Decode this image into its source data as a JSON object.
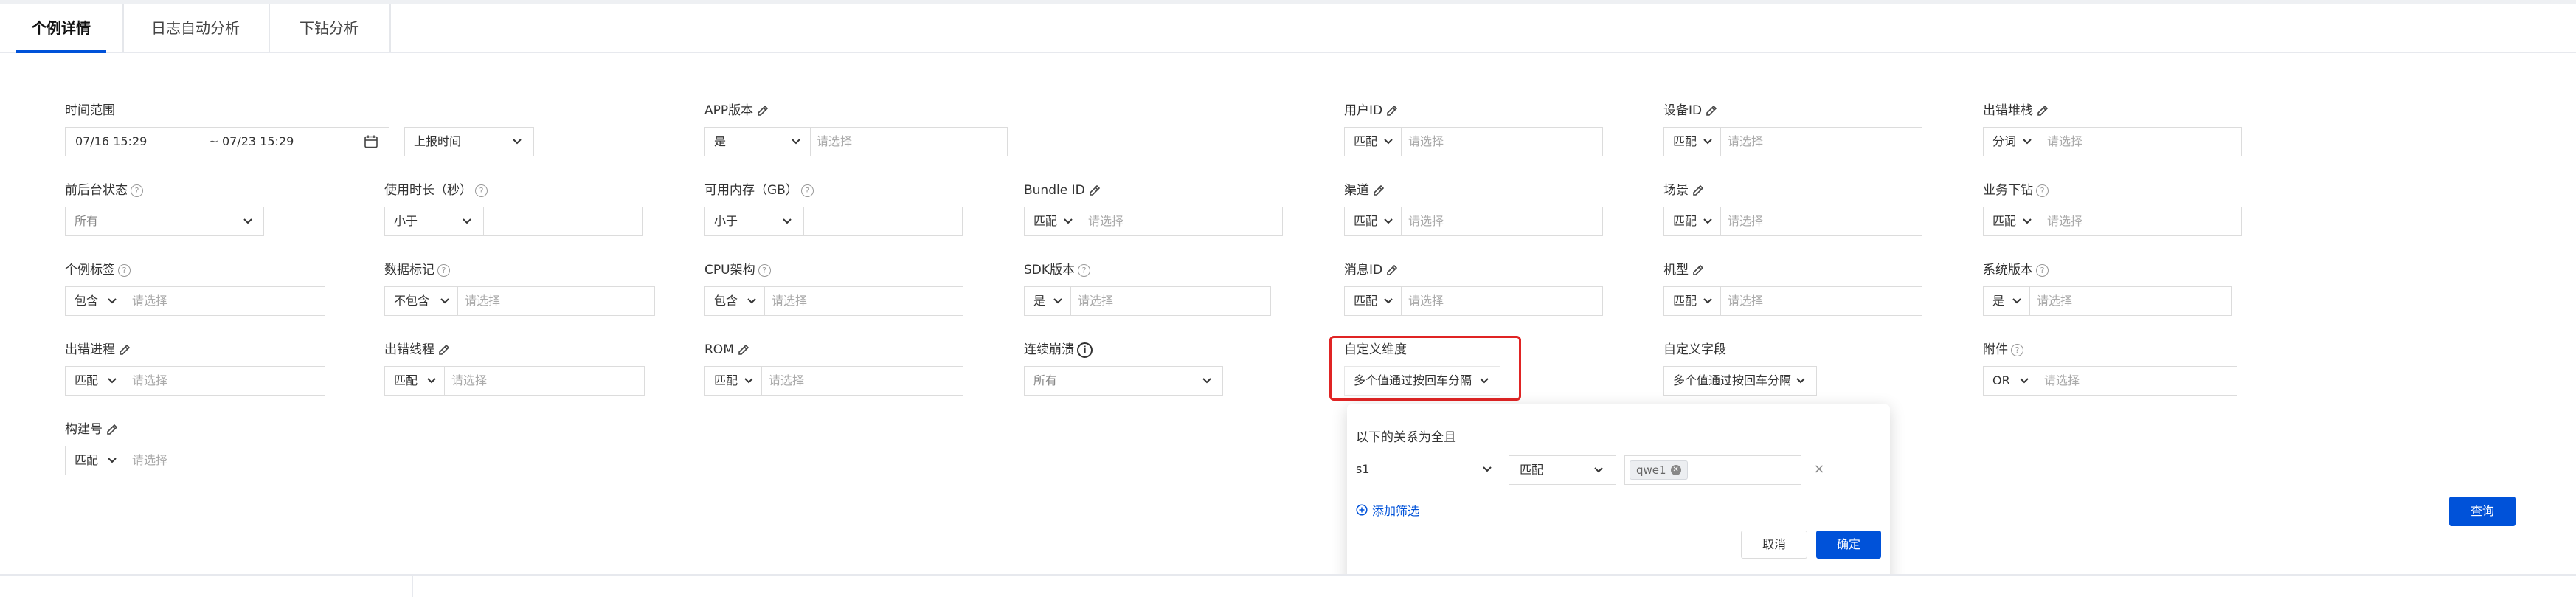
{
  "tabs": [
    {
      "label": "个例详情",
      "active": true
    },
    {
      "label": "日志自动分析",
      "active": false
    },
    {
      "label": "下钻分析",
      "active": false
    }
  ],
  "filters": {
    "time_range": {
      "label": "时间范围",
      "start": "07/16 15:29",
      "separator": "~",
      "end": "07/23 15:29",
      "mode": "上报时间"
    },
    "app_version": {
      "label": "APP版本",
      "op": "是",
      "placeholder": "请选择"
    },
    "user_id": {
      "label": "用户ID",
      "op": "匹配",
      "placeholder": "请选择"
    },
    "device_id": {
      "label": "设备ID",
      "op": "匹配",
      "placeholder": "请选择"
    },
    "error_stack": {
      "label": "出错堆栈",
      "op": "分词",
      "placeholder": "请选择"
    },
    "fg_bg_state": {
      "label": "前后台状态",
      "value": "所有"
    },
    "usage_duration": {
      "label": "使用时长（秒）",
      "op": "小于",
      "value": ""
    },
    "available_memory": {
      "label": "可用内存（GB）",
      "op": "小于",
      "value": ""
    },
    "bundle_id": {
      "label": "Bundle ID",
      "op": "匹配",
      "placeholder": "请选择"
    },
    "channel": {
      "label": "渠道",
      "op": "匹配",
      "placeholder": "请选择"
    },
    "scene": {
      "label": "场景",
      "op": "匹配",
      "placeholder": "请选择"
    },
    "business_drill": {
      "label": "业务下钻",
      "op": "匹配",
      "placeholder": "请选择"
    },
    "case_tag": {
      "label": "个例标签",
      "op": "包含",
      "placeholder": "请选择"
    },
    "data_mark": {
      "label": "数据标记",
      "op": "不包含",
      "placeholder": "请选择"
    },
    "cpu_arch": {
      "label": "CPU架构",
      "op": "包含",
      "placeholder": "请选择"
    },
    "sdk_version": {
      "label": "SDK版本",
      "op": "是",
      "placeholder": "请选择"
    },
    "message_id": {
      "label": "消息ID",
      "op": "匹配",
      "placeholder": "请选择"
    },
    "device_model": {
      "label": "机型",
      "op": "匹配",
      "placeholder": "请选择"
    },
    "os_version": {
      "label": "系统版本",
      "op": "是",
      "placeholder": "请选择"
    },
    "error_process": {
      "label": "出错进程",
      "op": "匹配",
      "placeholder": "请选择"
    },
    "error_thread": {
      "label": "出错线程",
      "op": "匹配",
      "placeholder": "请选择"
    },
    "rom": {
      "label": "ROM",
      "op": "匹配",
      "placeholder": "请选择"
    },
    "consecutive_crash": {
      "label": "连续崩溃",
      "value": "所有"
    },
    "custom_dimension": {
      "label": "自定义维度",
      "value": "多个值通过按回车分隔"
    },
    "custom_field": {
      "label": "自定义字段",
      "value": "多个值通过按回车分隔"
    },
    "attachment": {
      "label": "附件",
      "op": "OR",
      "placeholder": "请选择"
    },
    "build_number": {
      "label": "构建号",
      "op": "匹配",
      "placeholder": "请选择"
    }
  },
  "popup": {
    "relation_text": "以下的关系为全且",
    "field": "s1",
    "op": "匹配",
    "tags": [
      "qwe1"
    ],
    "add_filter": "添加筛选",
    "cancel": "取消",
    "confirm": "确定"
  },
  "query_button": "查询",
  "colors": {
    "primary": "#0052d9",
    "highlight": "#e02424"
  },
  "icons": [
    "edit-icon",
    "help-icon",
    "info-icon",
    "calendar-icon",
    "chevron-down-icon",
    "add-circle-icon",
    "close-icon"
  ]
}
